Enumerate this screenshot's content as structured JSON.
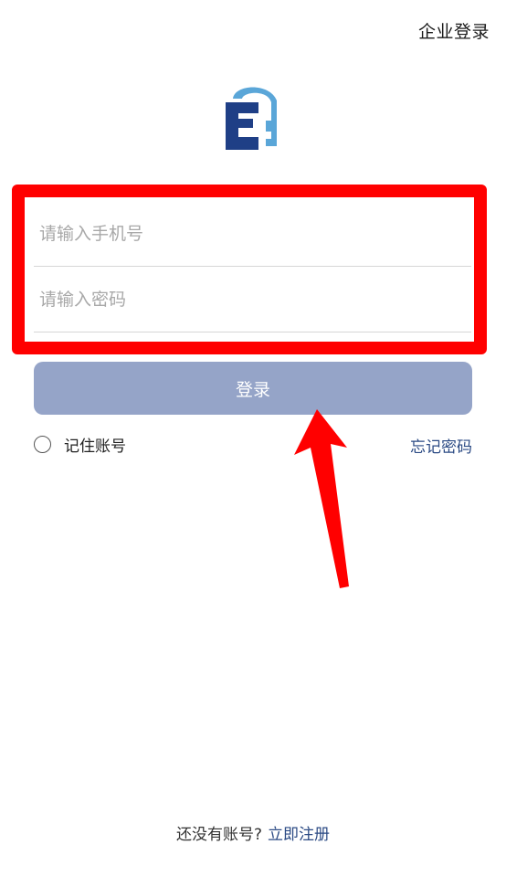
{
  "header": {
    "enterprise_login": "企业登录"
  },
  "logo": {
    "name": "E-logo",
    "colors": {
      "dark": "#1f3f86",
      "light": "#5aa6d8"
    }
  },
  "form": {
    "phone_placeholder": "请输入手机号",
    "password_placeholder": "请输入密码",
    "login_label": "登录",
    "remember_label": "记住账号",
    "forgot_label": "忘记密码"
  },
  "footer": {
    "no_account_text": "还没有账号?",
    "register_link": "立即注册"
  },
  "annotations": {
    "highlight_color": "#ff0000",
    "arrow_color": "#ff0000"
  }
}
